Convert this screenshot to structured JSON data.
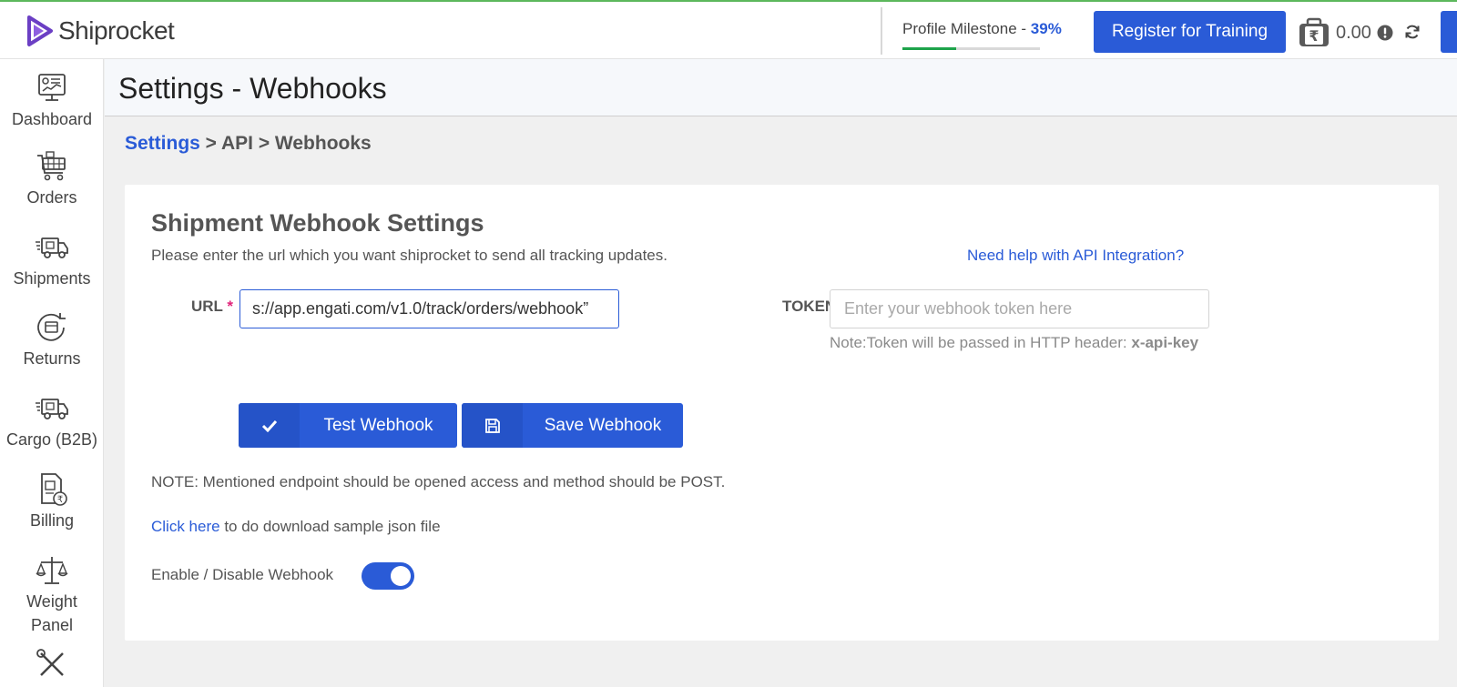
{
  "brand": {
    "name": "Shiprocket"
  },
  "topbar": {
    "milestone_label": "Profile Milestone - ",
    "milestone_percent_text": "39%",
    "milestone_progress": 0.39,
    "training_button": "Register for Training",
    "wallet_balance": "0.00"
  },
  "sidebar": {
    "items": [
      {
        "label": "Dashboard",
        "icon": "dashboard-icon"
      },
      {
        "label": "Orders",
        "icon": "orders-cart-icon"
      },
      {
        "label": "Shipments",
        "icon": "shipments-truck-icon"
      },
      {
        "label": "Returns",
        "icon": "returns-icon"
      },
      {
        "label": "Cargo (B2B)",
        "icon": "cargo-truck-icon"
      },
      {
        "label": "Billing",
        "icon": "billing-icon"
      },
      {
        "label": "Weight",
        "label2": "Panel",
        "icon": "weight-scale-icon"
      },
      {
        "label": "",
        "icon": "tools-icon"
      }
    ]
  },
  "page": {
    "title": "Settings - Webhooks",
    "breadcrumb": {
      "root": "Settings",
      "rest": " > API > Webhooks"
    }
  },
  "card": {
    "title": "Shipment Webhook Settings",
    "description": "Please enter the url which you want shiprocket to send all tracking updates.",
    "help_link": "Need help with API Integration?",
    "url_label": "URL",
    "url_required_mark": "*",
    "url_value": "s://app.engati.com/v1.0/track/orders/webhook”",
    "token_label": "TOKEN",
    "token_placeholder": "Enter your webhook token here",
    "token_note_prefix": "Note:Token will be passed in HTTP header: ",
    "token_note_key": "x-api-key",
    "test_button": "Test Webhook",
    "save_button": "Save Webhook",
    "note": "NOTE: Mentioned endpoint should be opened access and method should be POST.",
    "click_here": "Click here",
    "click_suffix": " to do download sample json file",
    "toggle_label": "Enable / Disable Webhook",
    "toggle_on": true
  },
  "colors": {
    "accent": "#2a5bd7",
    "progress": "#1ea34b",
    "required": "#e0237a"
  }
}
